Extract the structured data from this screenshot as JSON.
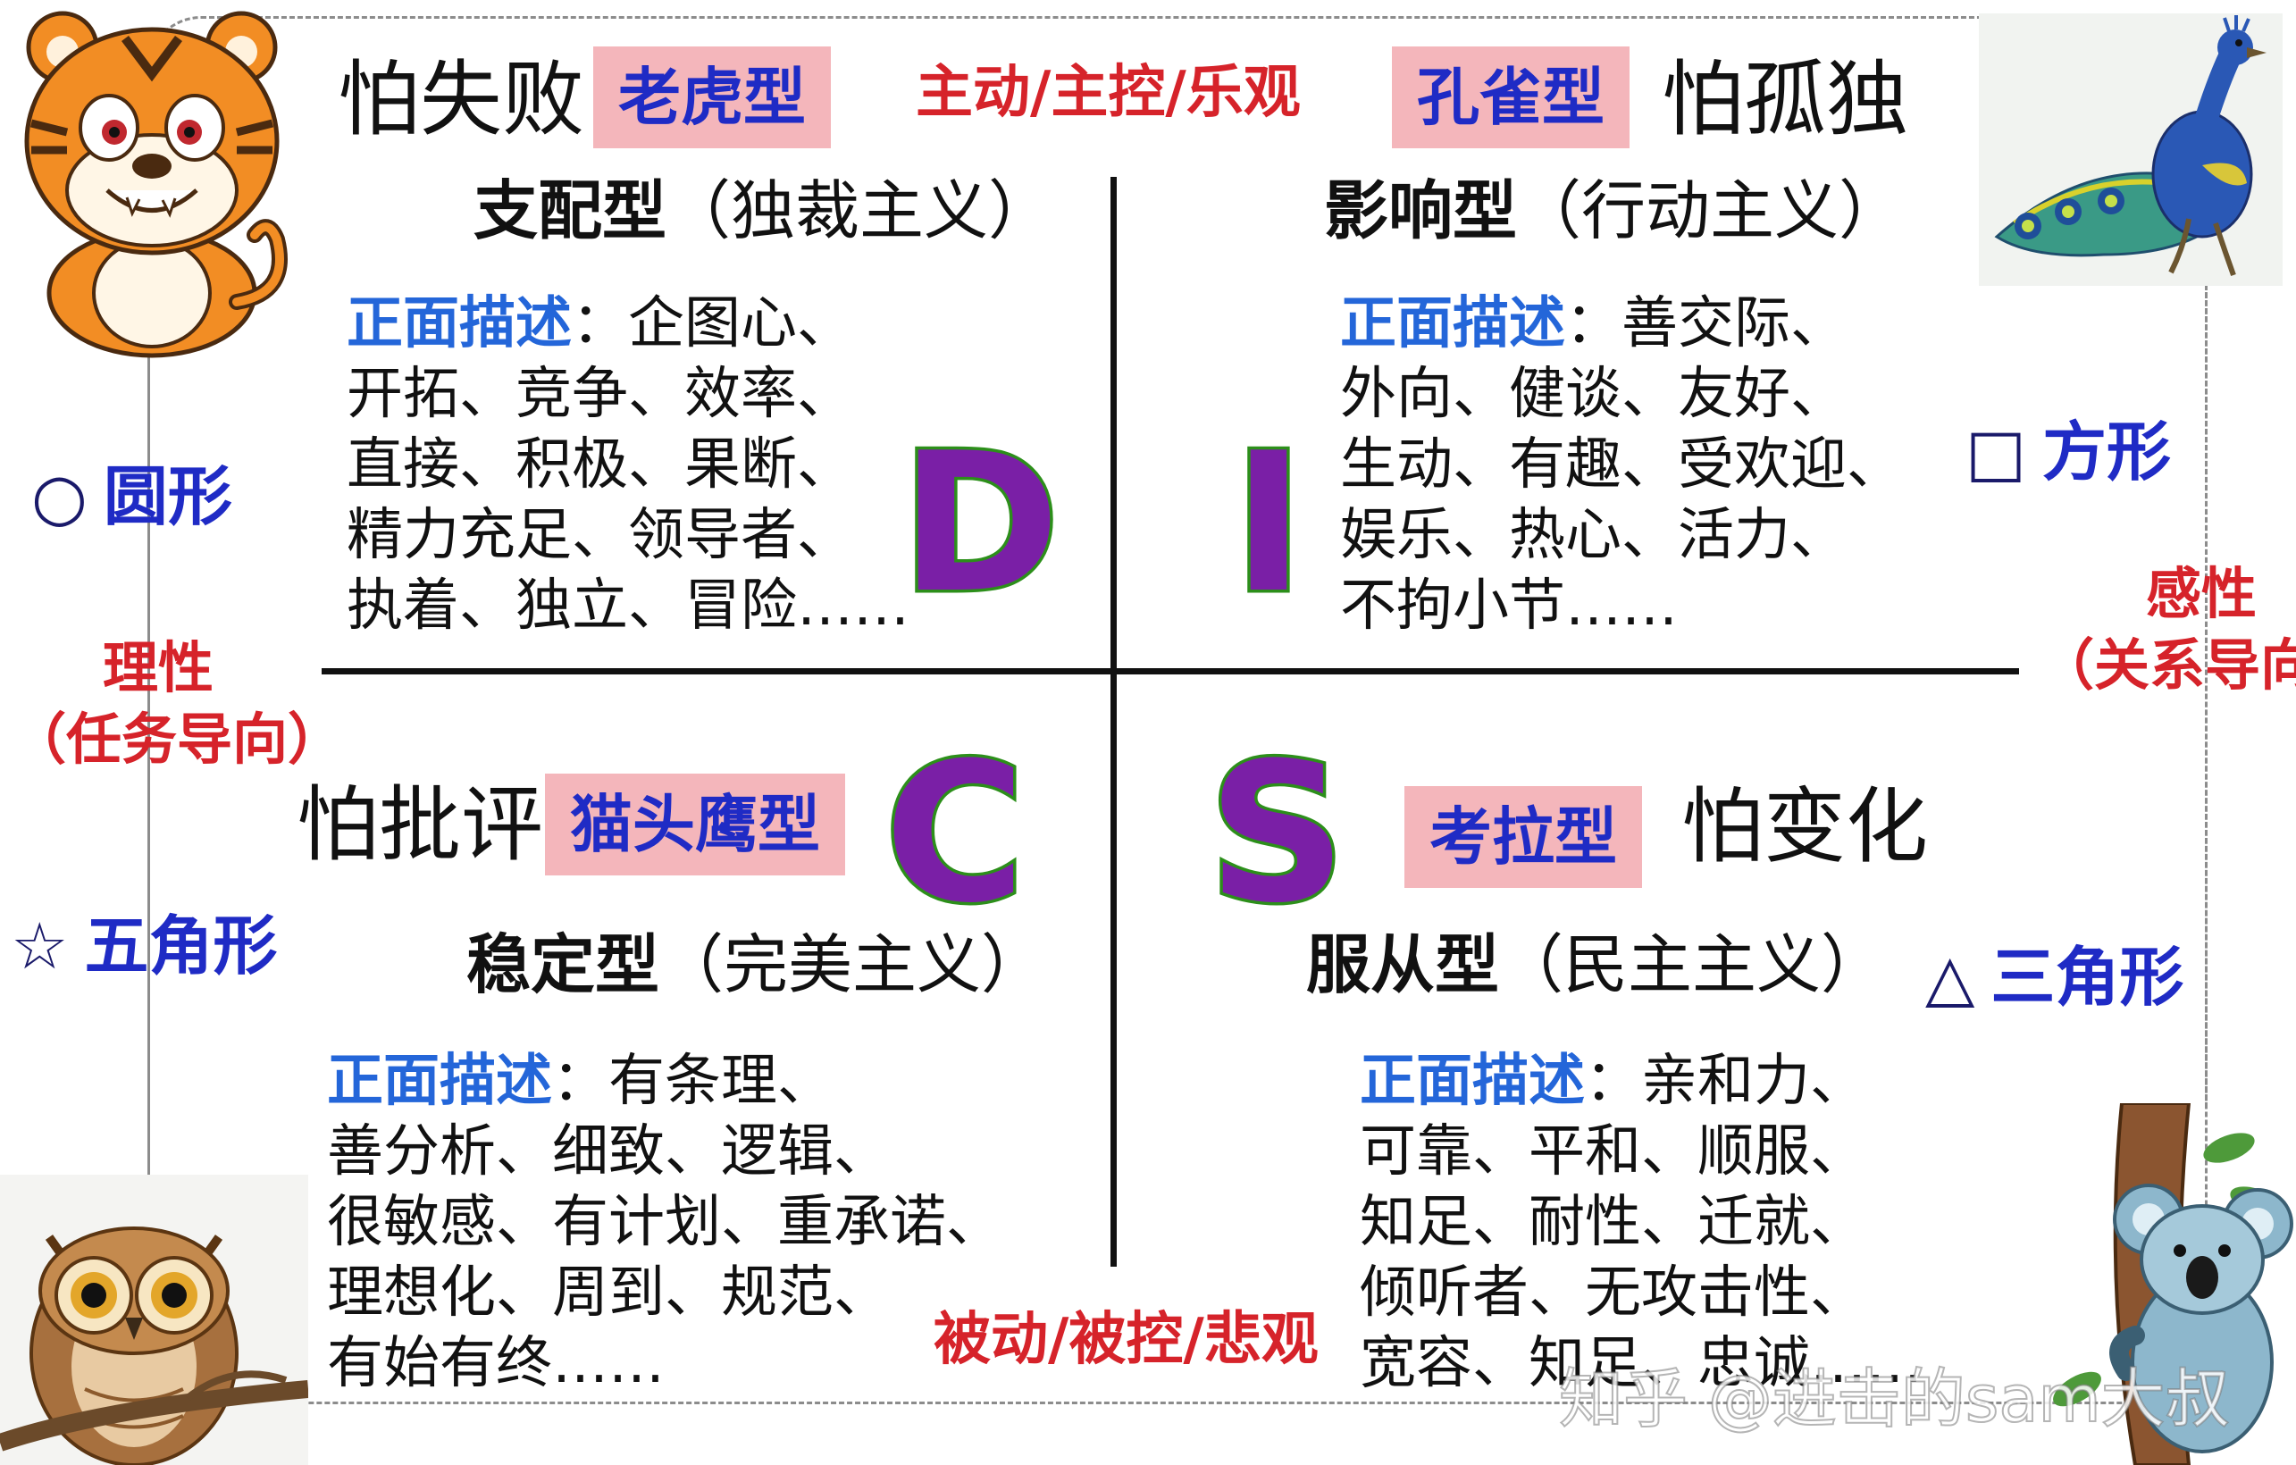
{
  "top": {
    "d_fear": "怕失败",
    "d_animal": "老虎型",
    "axis_active": "主动/主控/乐观",
    "i_animal": "孔雀型",
    "i_fear": "怕孤独"
  },
  "quadrants": {
    "d": {
      "title_bold": "支配型",
      "title_rest": "（独裁主义）",
      "label": "正面描述",
      "lines": [
        "：企图心、",
        "开拓、竞争、效率、",
        "直接、积极、果断、",
        "精力充足、领导者、",
        "执着、独立、冒险……"
      ],
      "letter": "D"
    },
    "i": {
      "title_bold": "影响型",
      "title_rest": "（行动主义）",
      "label": "正面描述",
      "lines": [
        "：善交际、",
        "外向、健谈、友好、",
        "生动、有趣、受欢迎、",
        "娱乐、热心、活力、",
        "不拘小节……"
      ],
      "letter": "I"
    },
    "c": {
      "fear": "怕批评",
      "animal": "猫头鹰型",
      "title_bold": "稳定型",
      "title_rest": "（完美主义）",
      "label": "正面描述",
      "lines": [
        "：有条理、",
        "善分析、细致、逻辑、",
        "很敏感、有计划、重承诺、",
        "理想化、周到、规范、",
        "有始有终……"
      ],
      "letter": "C"
    },
    "s": {
      "fear": "怕变化",
      "animal": "考拉型",
      "title_bold": "服从型",
      "title_rest": "（民主主义）",
      "label": "正面描述",
      "lines": [
        "：亲和力、",
        "可靠、平和、顺服、",
        "知足、耐性、迁就、",
        "倾听者、无攻击性、",
        "宽容、知足、忠诚……"
      ],
      "letter": "S"
    }
  },
  "bottom": {
    "axis_passive": "被动/被控/悲观"
  },
  "shapes": {
    "circle": {
      "symbol": "○",
      "label": "圆形"
    },
    "square": {
      "symbol": "□",
      "label": "方形"
    },
    "star": {
      "symbol": "☆",
      "label": "五角形"
    },
    "triangle": {
      "symbol": "△",
      "label": "三角形"
    }
  },
  "sides": {
    "left_line1": "理性",
    "left_line2": "（任务导向）",
    "right_line1": "感性",
    "right_line2": "（关系导向"
  },
  "watermark": "知乎 @进击的sam大叔",
  "colors": {
    "tag_bg": "#f4b6bb",
    "tag_text": "#1f2bc5",
    "axis_label": "#d6232a",
    "desc_label": "#2466d9",
    "letter_fill": "#7a1fa6",
    "letter_outline": "#2c8f1a"
  },
  "icons": [
    "tiger-icon",
    "peacock-icon",
    "owl-icon",
    "koala-icon"
  ]
}
